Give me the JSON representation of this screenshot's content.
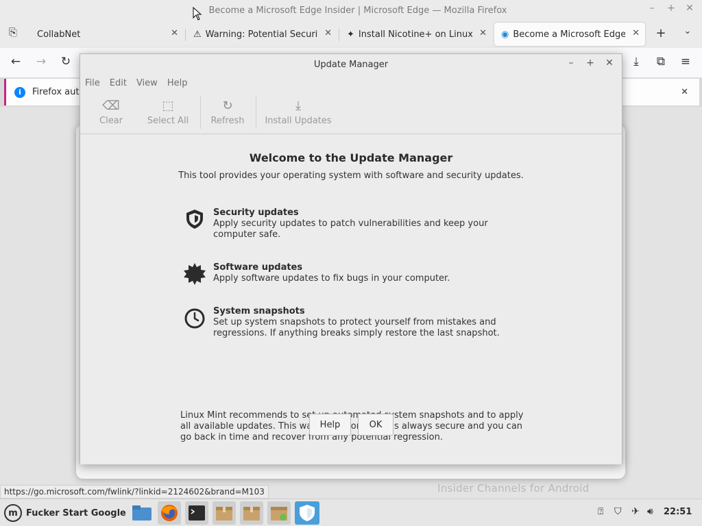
{
  "firefox": {
    "window_title": "Become a Microsoft Edge Insider | Microsoft Edge — Mozilla Firefox",
    "tabs": [
      {
        "title": "CollabNet"
      },
      {
        "title": "Warning: Potential Security Risk Ahead"
      },
      {
        "title": "Install Nicotine+ on Linux | Snapcraft"
      },
      {
        "title": "Become a Microsoft Edge Insider | Microsoft Edge"
      }
    ],
    "notification_text": "Firefox auto",
    "status_url": "https://go.microsoft.com/fwlink/?linkid=2124602&brand=M103",
    "page_ghost_text": "Insider Channels for Android"
  },
  "update_manager": {
    "title": "Update Manager",
    "menu": [
      "File",
      "Edit",
      "View",
      "Help"
    ],
    "toolbar": {
      "clear": "Clear",
      "select_all": "Select All",
      "refresh": "Refresh",
      "install_updates": "Install Updates"
    },
    "welcome_title": "Welcome to the Update Manager",
    "welcome_subtitle": "This tool provides your operating system with software and security updates.",
    "features": [
      {
        "title": "Security updates",
        "description": "Apply security updates to patch vulnerabilities and keep your computer safe.",
        "icon": "shield-icon"
      },
      {
        "title": "Software updates",
        "description": "Apply software updates to fix bugs in your computer.",
        "icon": "badge-icon"
      },
      {
        "title": "System snapshots",
        "description": "Set up system snapshots to protect yourself from mistakes and regressions. If anything breaks simply restore the last snapshot.",
        "icon": "clock-icon"
      }
    ],
    "recommendation": "Linux Mint recommends to set up automated system snapshots and to apply all available updates. This way, your computer is always secure and you can go back in time and recover from any potential regression.",
    "buttons": {
      "help": "Help",
      "ok": "OK"
    }
  },
  "taskbar": {
    "start_label": "Fucker Start Google",
    "clock": "22:51"
  },
  "colors": {
    "accent": "#4a9fd8",
    "notice_border": "#c6257f"
  }
}
